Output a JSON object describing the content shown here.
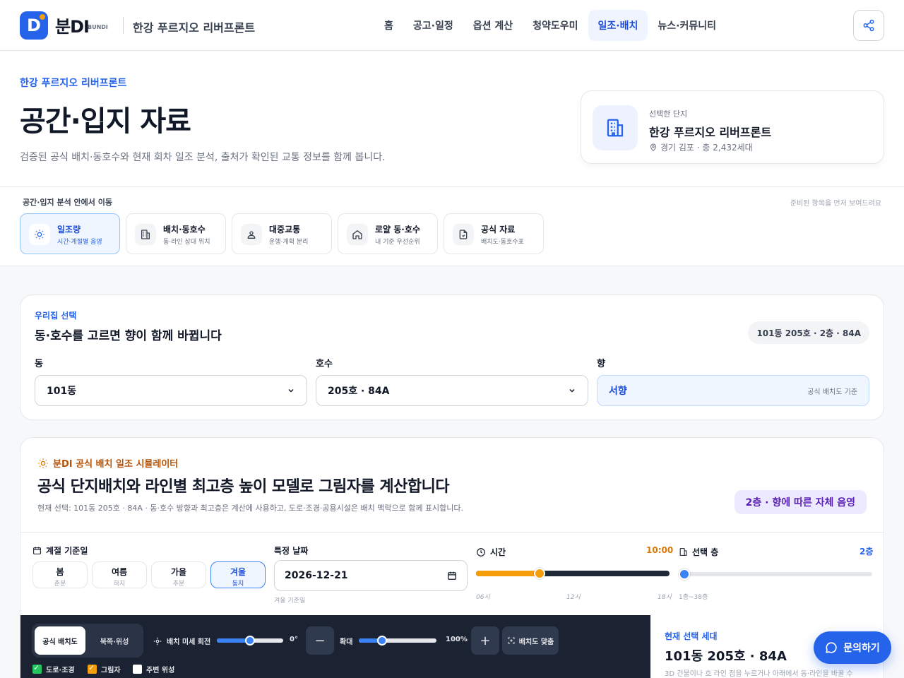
{
  "brand": {
    "name": "분DI",
    "sub": "BUNDI",
    "logo_letter": "D",
    "accent": "#2563eb"
  },
  "header": {
    "complex": "한강 푸르지오 리버프론트",
    "nav": [
      "홈",
      "공고·일정",
      "옵션 계산",
      "청약도우미",
      "일조·배치",
      "뉴스·커뮤니티"
    ],
    "active_nav": "일조·배치",
    "share_icon": "share-icon"
  },
  "hero": {
    "eyebrow": "한강 푸르지오 리버프론트",
    "title": "공간·입지 자료",
    "desc": "검증된 공식 배치·동호수와 현재 회차 일조 분석, 출처가 확인된 교통 정보를 함께 봅니다.",
    "selected": {
      "label": "선택한 단지",
      "name": "한강 푸르지오 리버프론트",
      "meta": "경기 김포 · 총 2,432세대"
    }
  },
  "subnav": {
    "title": "공간·입지 분석 안에서 이동",
    "hint": "준비된 항목을 먼저 보여드려요",
    "items": [
      {
        "title": "일조량",
        "sub": "시간·계절별 음영",
        "icon": "sun-icon"
      },
      {
        "title": "배치·동호수",
        "sub": "동·라인 상대 위치",
        "icon": "building-icon"
      },
      {
        "title": "대중교통",
        "sub": "운행·계획 분리",
        "icon": "location-icon"
      },
      {
        "title": "로얄 동·호수",
        "sub": "내 기준 우선순위",
        "icon": "home-icon"
      },
      {
        "title": "공식 자료",
        "sub": "배치도·동호수표",
        "icon": "document-icon"
      }
    ]
  },
  "unit": {
    "eyebrow": "우리집 선택",
    "title": "동·호수를 고르면 향이 함께 바뀝니다",
    "summary": "101동 205호 · 2층 · 84A",
    "dong_label": "동",
    "dong_value": "101동",
    "ho_label": "호수",
    "ho_value": "205호 · 84A",
    "dir_label": "향",
    "dir_value": "서향",
    "dir_note": "공식 배치도 기준"
  },
  "sim": {
    "eyebrow": "분DI 공식 배치 일조 시뮬레이터",
    "title": "공식 단지배치와 라인별 최고층 높이 모델로 그림자를 계산합니다",
    "desc": "현재 선택: 101동 205호 · 84A · 동·호수 방향과 최고층은 계산에 사용하고, 도로·조경·공용시설은 배치 맥락으로 함께 표시합니다.",
    "badge": "2층 · 향에 따른 자체 음영",
    "season_label": "계절 기준일",
    "seasons": [
      {
        "n": "봄",
        "s": "춘분"
      },
      {
        "n": "여름",
        "s": "하지"
      },
      {
        "n": "가을",
        "s": "추분"
      },
      {
        "n": "겨울",
        "s": "동지"
      }
    ],
    "active_season": 3,
    "date_label": "특정 날짜",
    "date_value": "2026-12-21",
    "date_hint": "겨울 기준일",
    "time_label": "시간",
    "time_value": "10:00",
    "time_ticks": [
      "06시",
      "12시",
      "18시"
    ],
    "time_fraction": 0.33,
    "floor_label": "선택 층",
    "floor_value": "2층",
    "floor_range": "1층~38층",
    "floor_fraction": 0.03,
    "viewer": {
      "tab_a": "공식 배치도",
      "tab_b": "북쪽·위성",
      "rotate_label": "배치 미세 회전",
      "rotate_value": "0°",
      "rotate_fraction": 0.5,
      "zoom_label": "확대",
      "zoom_value": "100%",
      "zoom_fraction": 0.3,
      "minus": "−",
      "plus": "+",
      "fit_label": "배치도 맞춤",
      "layers": [
        {
          "label": "도로·조경",
          "on": true,
          "color": "#22c55e"
        },
        {
          "label": "그림자",
          "on": true,
          "color": "#f59e0b"
        },
        {
          "label": "주변 위성",
          "on": false,
          "color": "#ffffff"
        }
      ]
    },
    "side": {
      "eyebrow": "현재 선택 세대",
      "title": "101동 205호 · 84A",
      "desc": "3D 건물이나 호 라인 점을 누르거나 아래에서 동·라인을 바꿀 수"
    }
  },
  "fab": {
    "label": "문의하기"
  }
}
